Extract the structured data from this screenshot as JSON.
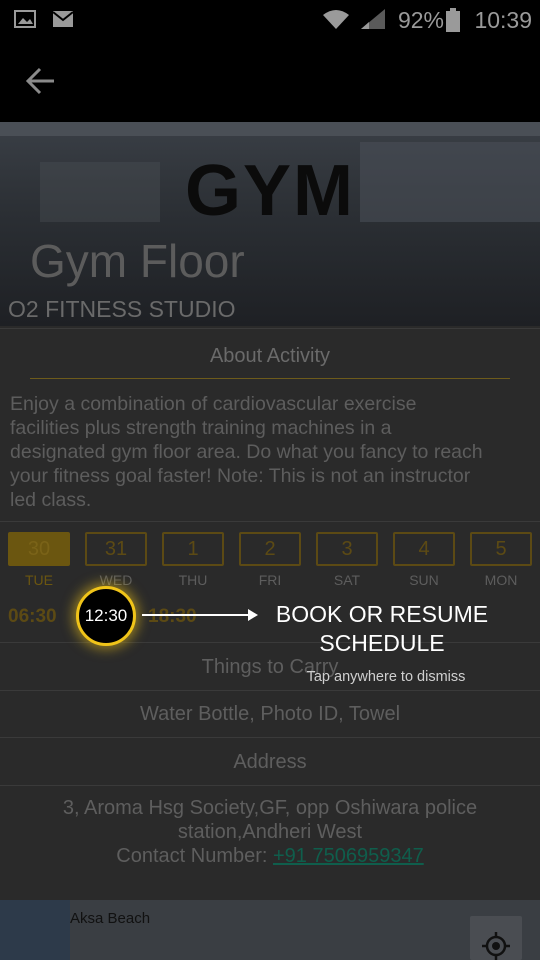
{
  "status": {
    "battery": "92%",
    "time": "10:39"
  },
  "hero": {
    "title": "GYM",
    "activity": "Gym Floor",
    "studio": "O2 FITNESS STUDIO"
  },
  "about": {
    "title": "About Activity",
    "lines": [
      "Enjoy a combination of cardiovascular exercise",
      "facilities plus strength training machines in a",
      "designated gym floor area. Do what you fancy to reach",
      "your fitness goal faster! Note: This is not an instructor",
      "led class."
    ]
  },
  "days": [
    {
      "num": "30",
      "day": "TUE"
    },
    {
      "num": "31",
      "day": "WED"
    },
    {
      "num": "1",
      "day": "THU"
    },
    {
      "num": "2",
      "day": "FRI"
    },
    {
      "num": "3",
      "day": "SAT"
    },
    {
      "num": "4",
      "day": "SUN"
    },
    {
      "num": "5",
      "day": "MON"
    }
  ],
  "slots": {
    "first": "06:30",
    "highlighted": "12:30",
    "third": "18:30"
  },
  "carry": {
    "title": "Things to Carry",
    "items": "Water Bottle, Photo ID, Towel"
  },
  "address": {
    "title": "Address",
    "line1": "3, Aroma Hsg Society,GF, opp Oshiwara police",
    "line2": "station,Andheri West",
    "contact_label": "Contact Number: ",
    "contact_number": "+91 7506959347"
  },
  "map": {
    "place": "Aksa Beach"
  },
  "tutorial": {
    "line1": "BOOK OR RESUME",
    "line2": "SCHEDULE",
    "dismiss": "Tap anywhere to dismiss"
  },
  "colors": {
    "accent": "#f0c419",
    "link": "#0f5e4c"
  }
}
